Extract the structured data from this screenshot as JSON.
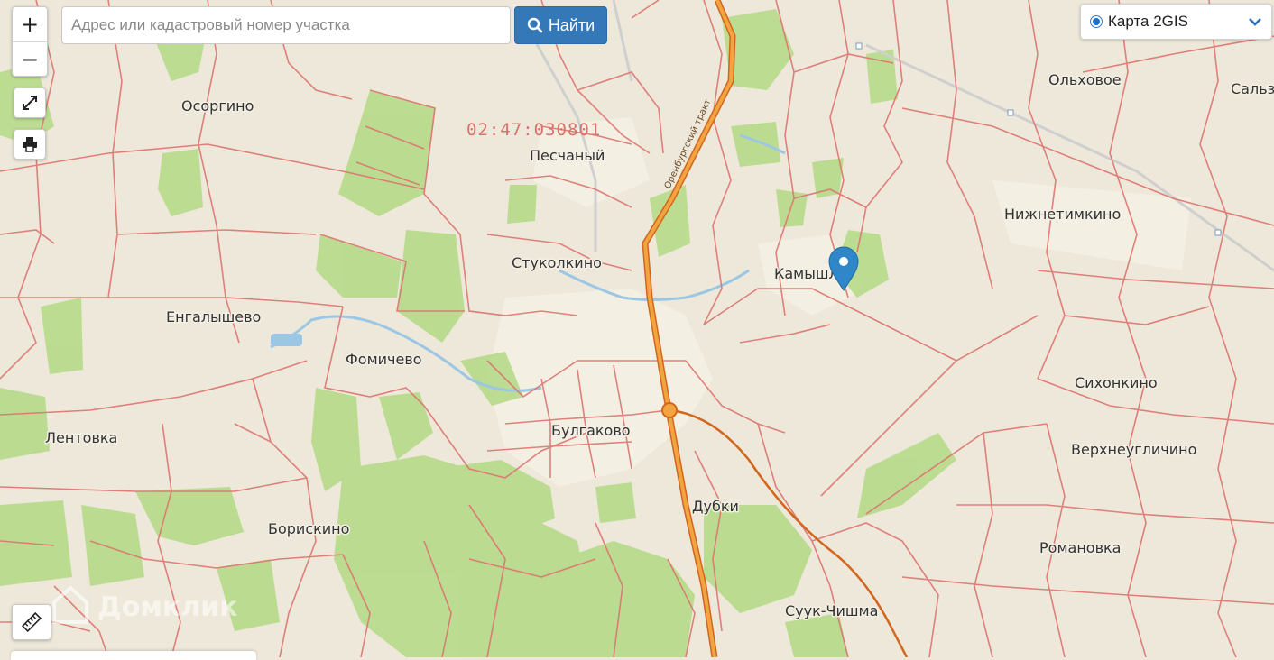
{
  "controls": {
    "zoom_in": "+",
    "zoom_out": "−"
  },
  "search": {
    "placeholder": "Адрес или кадастровый номер участка",
    "button_label": "Найти"
  },
  "layer_switcher": {
    "selected": "Карта 2GIS"
  },
  "cadastral_number": "02:47:030801",
  "road_name": "Оренбургский тракт",
  "watermark": "Домклик",
  "places": {
    "osorgino": "Осоргино",
    "peschany": "Песчаный",
    "stukolkino": "Стуколкино",
    "engalyshevo": "Енгалышево",
    "fomichevo": "Фомичево",
    "lentovka": "Лентовка",
    "bulgakovo": "Булгаково",
    "borisskino": "Борискино",
    "dubki": "Дубки",
    "kamyshly": "Камышл",
    "nizhnetimkino": "Нижнетимкино",
    "olkhovoe": "Ольховое",
    "salz": "Сальз",
    "sikhonkino": "Сихонкино",
    "verkhneuglichino": "Верхнеугличино",
    "romanovka": "Романовка",
    "suuk_chishma": "Суук-Чишма"
  },
  "colors": {
    "background": "#ede8d9",
    "forest": "#b9db8e",
    "parcel_border": "#dd7470",
    "highway": "#ef9a33",
    "highway_border": "#d2661e",
    "water": "#9cc7e4",
    "marker": "#2f86c8",
    "button": "#3478b8"
  }
}
